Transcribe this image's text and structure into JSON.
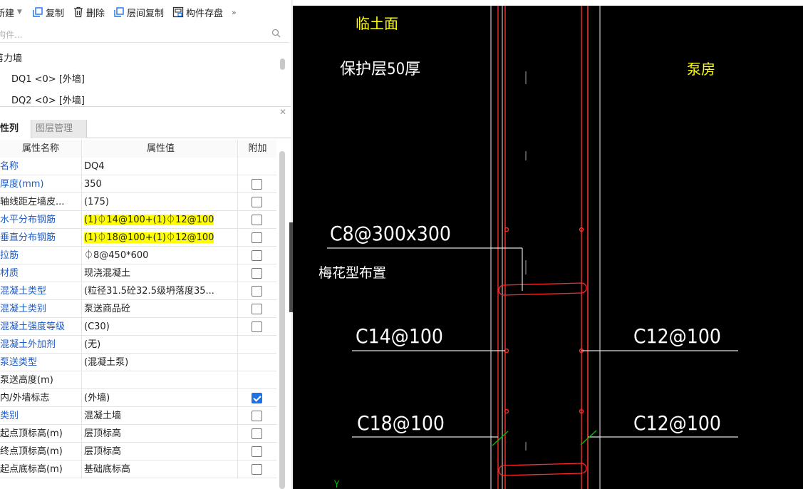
{
  "toolbar": {
    "new_label": "新建",
    "copy_label": "复制",
    "delete_label": "删除",
    "floor_copy_label": "层间复制",
    "save_label": "构件存盘",
    "more_label": "»"
  },
  "search": {
    "placeholder": "构件..."
  },
  "tree": {
    "category": "剪力墙",
    "items": [
      {
        "label": "DQ1 <0> [外墙]"
      },
      {
        "label": "DQ2 <0> [外墙]"
      }
    ]
  },
  "tabs": {
    "list_label": "性列表",
    "layer_label": "图层管理"
  },
  "table": {
    "headers": {
      "name": "属性名称",
      "value": "属性值",
      "extra": "附加"
    },
    "rows": [
      {
        "name": "名称",
        "value": "DQ4",
        "checkbox": "none"
      },
      {
        "name": "厚度(mm)",
        "value": "350",
        "checkbox": "unchecked"
      },
      {
        "name": "轴线距左墙皮...",
        "value": "(175)",
        "checkbox": "unchecked",
        "black": true
      },
      {
        "name": "水平分布钢筋",
        "value": "(1)⏀14@100+(1)⏀12@100",
        "checkbox": "unchecked",
        "highlight": true
      },
      {
        "name": "垂直分布钢筋",
        "value": "(1)⏀18@100+(1)⏀12@100",
        "checkbox": "unchecked",
        "highlight": true
      },
      {
        "name": "拉筋",
        "value": "⏀8@450*600",
        "checkbox": "unchecked"
      },
      {
        "name": "材质",
        "value": "现浇混凝土",
        "checkbox": "unchecked"
      },
      {
        "name": "混凝土类型",
        "value": "(粒径31.5砼32.5级坍落度35...",
        "checkbox": "unchecked"
      },
      {
        "name": "混凝土类别",
        "value": "泵送商品砼",
        "checkbox": "unchecked"
      },
      {
        "name": "混凝土强度等级",
        "value": "(C30)",
        "checkbox": "unchecked"
      },
      {
        "name": "混凝土外加剂",
        "value": "(无)",
        "checkbox": "none"
      },
      {
        "name": "泵送类型",
        "value": "(混凝土泵)",
        "checkbox": "none"
      },
      {
        "name": "泵送高度(m)",
        "value": "",
        "checkbox": "none",
        "black": true
      },
      {
        "name": "内/外墙标志",
        "value": "(外墙)",
        "checkbox": "checked",
        "black": true
      },
      {
        "name": "类别",
        "value": "混凝土墙",
        "checkbox": "unchecked"
      },
      {
        "name": "起点顶标高(m)",
        "value": "层顶标高",
        "checkbox": "unchecked",
        "black": true
      },
      {
        "name": "终点顶标高(m)",
        "value": "层顶标高",
        "checkbox": "unchecked",
        "black": true
      },
      {
        "name": "起点底标高(m)",
        "value": "基础底标高",
        "checkbox": "unchecked",
        "black": true
      }
    ]
  },
  "cad": {
    "label_soil_face": "临土面",
    "label_cover": "保护层50厚",
    "label_pump_room": "泵房",
    "label_tie_spec": "C8@300x300",
    "label_plum": "梅花型布置",
    "label_h_outer": "C14@100",
    "label_h_inner": "C12@100",
    "label_v_outer": "C18@100",
    "label_v_inner": "C12@100",
    "axis_y": "Y",
    "colors": {
      "background": "#000000",
      "text": "#ffffff",
      "note": "#ffff00",
      "rebar": "#ff2a2a",
      "grid": "#c8c8c8",
      "tick": "#00c000"
    }
  }
}
